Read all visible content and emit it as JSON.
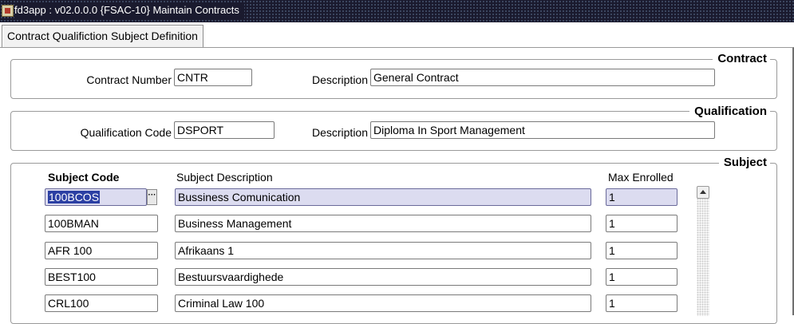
{
  "window": {
    "title": "fd3app : v02.0.0.0  {FSAC-10} Maintain Contracts"
  },
  "tab": {
    "label": "Contract Qualifiction Subject Definition"
  },
  "contract": {
    "title": "Contract",
    "number_label": "Contract Number",
    "number_value": "CNTR",
    "description_label": "Description",
    "description_value": "General Contract"
  },
  "qualification": {
    "title": "Qualification",
    "code_label": "Qualification Code",
    "code_value": "DSPORT",
    "description_label": "Description",
    "description_value": "Diploma In Sport Management"
  },
  "subject": {
    "title": "Subject",
    "headers": {
      "code": "Subject Code",
      "description": "Subject Description",
      "max": "Max Enrolled"
    },
    "lookup_glyph": "···",
    "rows": [
      {
        "code": "100BCOS",
        "description": "Bussiness Comunication",
        "max": "1"
      },
      {
        "code": "100BMAN",
        "description": "Business Management",
        "max": "1"
      },
      {
        "code": "AFR 100",
        "description": "Afrikaans 1",
        "max": "1"
      },
      {
        "code": "BEST100",
        "description": "Bestuursvaardighede",
        "max": "1"
      },
      {
        "code": "CRL100",
        "description": "Criminal Law 100",
        "max": "1"
      }
    ]
  },
  "icons": {
    "app": "app-icon",
    "lookup": "ellipsis-icon",
    "scroll_up": "arrow-up-icon"
  },
  "colors": {
    "titlebar": "#1a1a2e",
    "active_row": "#dcdcf0",
    "selection": "#2b3fa3"
  }
}
